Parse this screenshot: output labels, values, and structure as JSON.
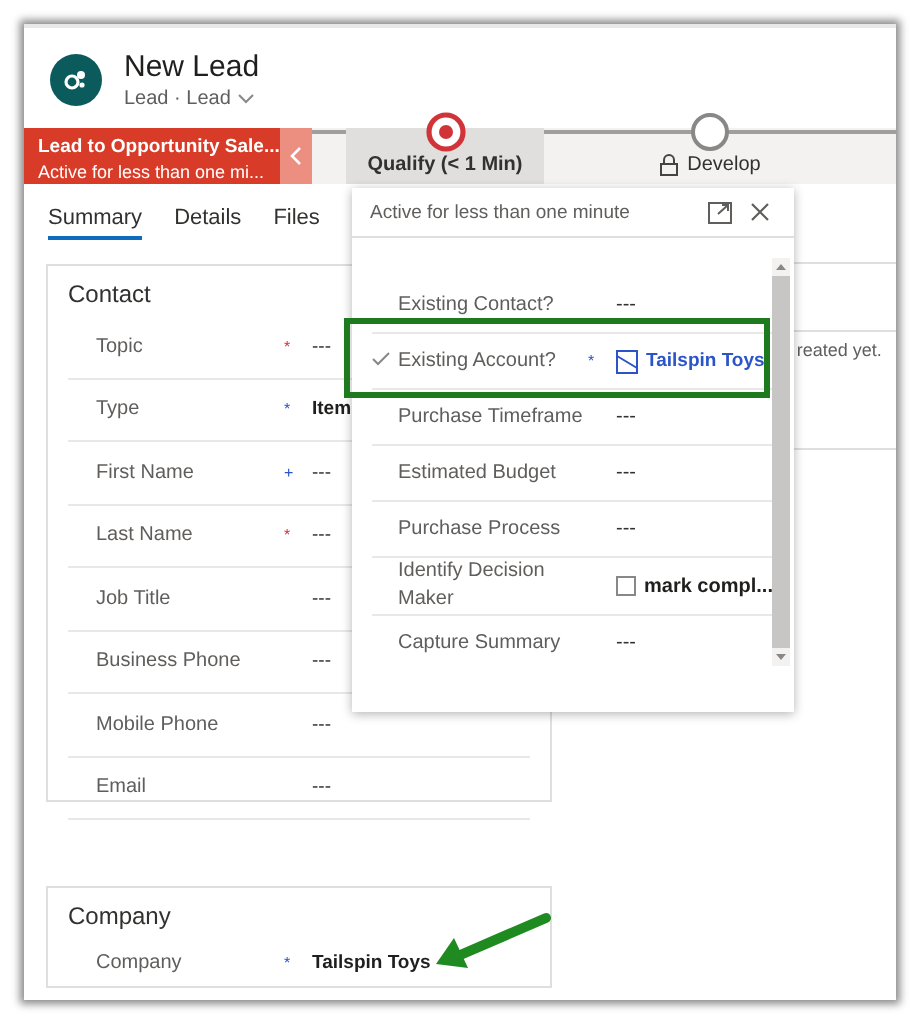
{
  "header": {
    "title": "New Lead",
    "subtitle": "Lead · Lead"
  },
  "process": {
    "name": "Lead to Opportunity Sale...",
    "status": "Active for less than one mi...",
    "stages": [
      {
        "label": "Qualify  (< 1 Min)",
        "current": true,
        "locked": false,
        "selected": true
      },
      {
        "label": "Develop",
        "current": false,
        "locked": true,
        "selected": false
      }
    ]
  },
  "tabs": [
    {
      "label": "Summary",
      "selected": true
    },
    {
      "label": "Details",
      "selected": false
    },
    {
      "label": "Files",
      "selected": false
    }
  ],
  "contact": {
    "title": "Contact",
    "fields": [
      {
        "label": "Topic",
        "marker": "*",
        "required": true,
        "value": "---"
      },
      {
        "label": "Type",
        "marker": "*",
        "required": false,
        "value": "Item"
      },
      {
        "label": "First Name",
        "marker": "+",
        "required": false,
        "value": "---"
      },
      {
        "label": "Last Name",
        "marker": "*",
        "required": true,
        "value": "---"
      },
      {
        "label": "Job Title",
        "value": "---"
      },
      {
        "label": "Business Phone",
        "value": "---"
      },
      {
        "label": "Mobile Phone",
        "value": "---"
      },
      {
        "label": "Email",
        "value": "---"
      }
    ]
  },
  "company": {
    "title": "Company",
    "fields": [
      {
        "label": "Company",
        "marker": "*",
        "required": false,
        "value": "Tailspin Toys"
      }
    ]
  },
  "side_panel": {
    "text": "reated yet."
  },
  "flyout": {
    "title": "Active for less than one minute",
    "steps": [
      {
        "label": "Existing Contact?",
        "done": false,
        "kind": "text",
        "value": "---"
      },
      {
        "label": "Existing Account?",
        "done": true,
        "marker": "*",
        "required": false,
        "kind": "link",
        "value": "Tailspin Toys"
      },
      {
        "label": "Purchase Timeframe",
        "done": false,
        "kind": "text",
        "value": "---"
      },
      {
        "label": "Estimated Budget",
        "done": false,
        "kind": "text",
        "value": "---"
      },
      {
        "label": "Purchase Process",
        "done": false,
        "kind": "text",
        "value": "---"
      },
      {
        "label": "Identify Decision Maker",
        "done": false,
        "kind": "checkbox",
        "checked": false,
        "value": "mark compl..."
      },
      {
        "label": "Capture Summary",
        "done": false,
        "kind": "text",
        "value": "---"
      }
    ]
  }
}
